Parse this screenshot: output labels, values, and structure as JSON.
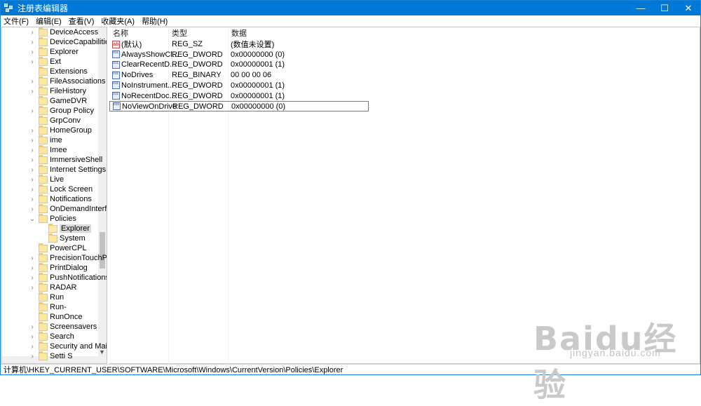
{
  "window": {
    "title": "注册表编辑器",
    "minimize_glyph": "—",
    "maximize_glyph": "☐",
    "close_glyph": "✕"
  },
  "menu": [
    "文件(F)",
    "编辑(E)",
    "查看(V)",
    "收藏夹(A)",
    "帮助(H)"
  ],
  "tree": {
    "items": [
      {
        "label": "DeviceAccess",
        "expander": "›"
      },
      {
        "label": "DeviceCapabilities",
        "expander": "›"
      },
      {
        "label": "Explorer",
        "expander": "›"
      },
      {
        "label": "Ext",
        "expander": "›"
      },
      {
        "label": "Extensions",
        "expander": ""
      },
      {
        "label": "FileAssociations",
        "expander": "›"
      },
      {
        "label": "FileHistory",
        "expander": "›"
      },
      {
        "label": "GameDVR",
        "expander": ""
      },
      {
        "label": "Group Policy",
        "expander": "›"
      },
      {
        "label": "GrpConv",
        "expander": ""
      },
      {
        "label": "HomeGroup",
        "expander": "›"
      },
      {
        "label": "ime",
        "expander": "›"
      },
      {
        "label": "Imee",
        "expander": "›"
      },
      {
        "label": "ImmersiveShell",
        "expander": "›"
      },
      {
        "label": "Internet Settings",
        "expander": "›"
      },
      {
        "label": "Live",
        "expander": "›"
      },
      {
        "label": "Lock Screen",
        "expander": "›"
      },
      {
        "label": "Notifications",
        "expander": "›"
      },
      {
        "label": "OnDemandInterfa",
        "expander": "›"
      },
      {
        "label": "Policies",
        "expander": "⌄"
      },
      {
        "label": "Explorer",
        "expander": "",
        "child": true,
        "selected": true
      },
      {
        "label": "System",
        "expander": "",
        "child": true
      },
      {
        "label": "PowerCPL",
        "expander": ""
      },
      {
        "label": "PrecisionTouchPa",
        "expander": "›"
      },
      {
        "label": "PrintDialog",
        "expander": "›"
      },
      {
        "label": "PushNotifications",
        "expander": "›"
      },
      {
        "label": "RADAR",
        "expander": "›"
      },
      {
        "label": "Run",
        "expander": ""
      },
      {
        "label": "Run-",
        "expander": ""
      },
      {
        "label": "RunOnce",
        "expander": ""
      },
      {
        "label": "Screensavers",
        "expander": "›"
      },
      {
        "label": "Search",
        "expander": "›"
      },
      {
        "label": "Security and Mair",
        "expander": "›"
      },
      {
        "label": "Setti  S",
        "expander": "›"
      }
    ]
  },
  "list": {
    "headers": {
      "name": "名称",
      "type": "类型",
      "data": "数据"
    },
    "rows": [
      {
        "icon": "string-value-icon",
        "icon_glyph": "ab",
        "name": "(默认)",
        "type": "REG_SZ",
        "data": "(数值未设置)"
      },
      {
        "icon": "binary-value-icon",
        "icon_glyph": "",
        "name": "AlwaysShowCl...",
        "type": "REG_DWORD",
        "data": "0x00000000 (0)"
      },
      {
        "icon": "binary-value-icon",
        "icon_glyph": "",
        "name": "ClearRecentD...",
        "type": "REG_DWORD",
        "data": "0x00000001 (1)"
      },
      {
        "icon": "binary-value-icon",
        "icon_glyph": "",
        "name": "NoDrives",
        "type": "REG_BINARY",
        "data": "00 00 00 06"
      },
      {
        "icon": "binary-value-icon",
        "icon_glyph": "",
        "name": "NoInstrument...",
        "type": "REG_DWORD",
        "data": "0x00000001 (1)"
      },
      {
        "icon": "binary-value-icon",
        "icon_glyph": "",
        "name": "NoRecentDoc...",
        "type": "REG_DWORD",
        "data": "0x00000001 (1)"
      },
      {
        "icon": "binary-value-icon",
        "icon_glyph": "",
        "name": "NoViewOnDrive",
        "type": "REG_DWORD",
        "data": "0x00000000 (0)",
        "selected": true
      }
    ]
  },
  "status": {
    "path": "计算机\\HKEY_CURRENT_USER\\SOFTWARE\\Microsoft\\Windows\\CurrentVersion\\Policies\\Explorer"
  },
  "watermark": {
    "logo": "Baidu经验",
    "url": "jingyan.baidu.com"
  }
}
